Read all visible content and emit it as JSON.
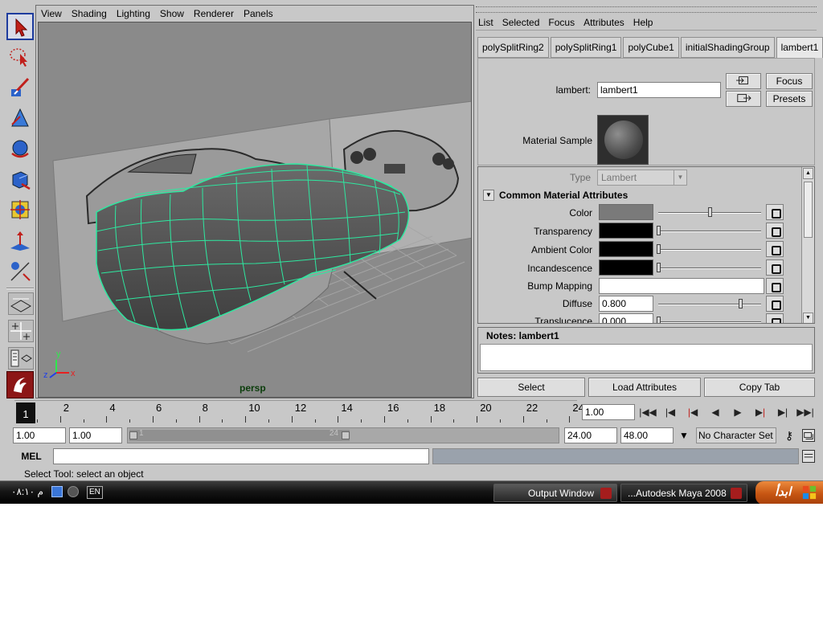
{
  "viewport": {
    "menu": [
      "View",
      "Shading",
      "Lighting",
      "Show",
      "Renderer",
      "Panels"
    ],
    "camera_label": "persp",
    "axis": {
      "x": "x",
      "y": "y",
      "z": "z"
    }
  },
  "attribute_editor": {
    "menu": [
      "List",
      "Selected",
      "Focus",
      "Attributes",
      "Help"
    ],
    "node_tabs": [
      "polySplitRing2",
      "polySplitRing1",
      "polyCube1",
      "initialShadingGroup",
      "lambert1"
    ],
    "active_tab": "lambert1",
    "name_label": "lambert:",
    "name_value": "lambert1",
    "focus_button": "Focus",
    "presets_button": "Presets",
    "material_sample_label": "Material Sample",
    "type_label": "Type",
    "type_value": "Lambert",
    "section_title": "Common Material Attributes",
    "attributes": {
      "color": {
        "label": "Color",
        "swatch": "#7a7a7a",
        "level": 0.5
      },
      "transparency": {
        "label": "Transparency",
        "swatch": "#000000",
        "level": 0.0
      },
      "ambient_color": {
        "label": "Ambient Color",
        "swatch": "#000000",
        "level": 0.0
      },
      "incandescence": {
        "label": "Incandescence",
        "swatch": "#000000",
        "level": 0.0
      },
      "bump_mapping": {
        "label": "Bump Mapping",
        "value": ""
      },
      "diffuse": {
        "label": "Diffuse",
        "value": "0.800",
        "level": 0.8
      },
      "translucence": {
        "label": "Translucence",
        "value": "0.000",
        "level": 0.0
      }
    },
    "notes_label": "Notes:  lambert1",
    "buttons": {
      "select": "Select",
      "load": "Load Attributes",
      "copy": "Copy Tab"
    }
  },
  "timeline": {
    "current_frame": "1",
    "ticks": [
      "2",
      "4",
      "6",
      "8",
      "10",
      "12",
      "14",
      "16",
      "18",
      "20",
      "22",
      "24"
    ],
    "current_time": "1.00"
  },
  "range": {
    "start": "1.00",
    "playback_start": "1.00",
    "range_start_label": "1",
    "range_end_label": "24",
    "playback_end": "24.00",
    "end": "48.00",
    "character_set": "No Character Set"
  },
  "command_line": {
    "label": "MEL",
    "value": ""
  },
  "help_line": "Select Tool: select an object",
  "taskbar": {
    "clock": "م ۰۸:۱۰",
    "language": "EN",
    "output_window": "Output Window",
    "maya_window": "...Autodesk Maya 2008",
    "start": "ابدأ"
  },
  "colors": {
    "wireframe": "#2ee8a0",
    "accent": "#1e3c9e"
  }
}
